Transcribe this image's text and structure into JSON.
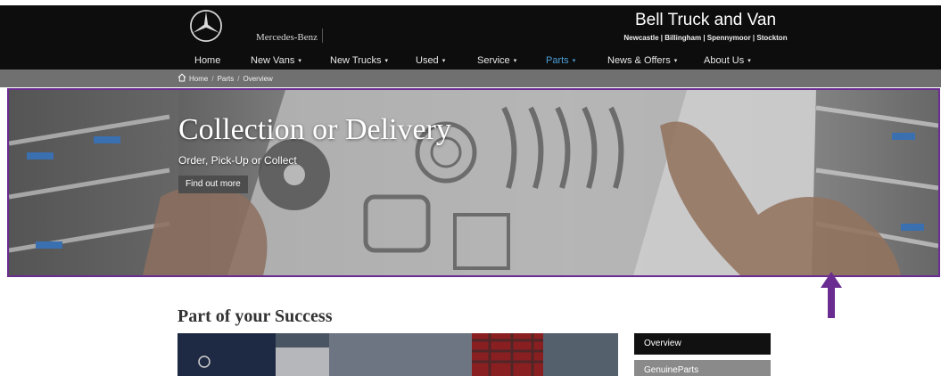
{
  "header": {
    "brand_name": "Mercedes-Benz",
    "dealer_name": "Bell Truck and Van",
    "locations": "Newcastle | Billingham | Spennymoor | Stockton"
  },
  "nav": {
    "items": [
      {
        "label": "Home",
        "dropdown": false
      },
      {
        "label": "New Vans",
        "dropdown": true
      },
      {
        "label": "New Trucks",
        "dropdown": true
      },
      {
        "label": "Used",
        "dropdown": true
      },
      {
        "label": "Service",
        "dropdown": true
      },
      {
        "label": "Parts",
        "dropdown": true,
        "active": true
      },
      {
        "label": "News & Offers",
        "dropdown": true
      },
      {
        "label": "About Us",
        "dropdown": true
      }
    ],
    "caret": "▾"
  },
  "breadcrumb": {
    "items": [
      "Home",
      "Parts",
      "Overview"
    ],
    "separator": "/"
  },
  "hero": {
    "title": "Collection or Delivery",
    "subtitle": "Order, Pick-Up or Collect",
    "button_label": "Find out more"
  },
  "content": {
    "section_title": "Part of your Success"
  },
  "side_menu": {
    "items": [
      "Overview",
      "GenuineParts"
    ]
  },
  "colors": {
    "active_nav": "#4b9fd5",
    "annotation": "#6a2c91",
    "header_bg": "#0d0d0d",
    "breadcrumb_bg": "#707070"
  },
  "icons": {
    "brand": "mercedes-star-icon",
    "breadcrumb_home": "home-icon",
    "annotation": "arrow-up-icon"
  }
}
